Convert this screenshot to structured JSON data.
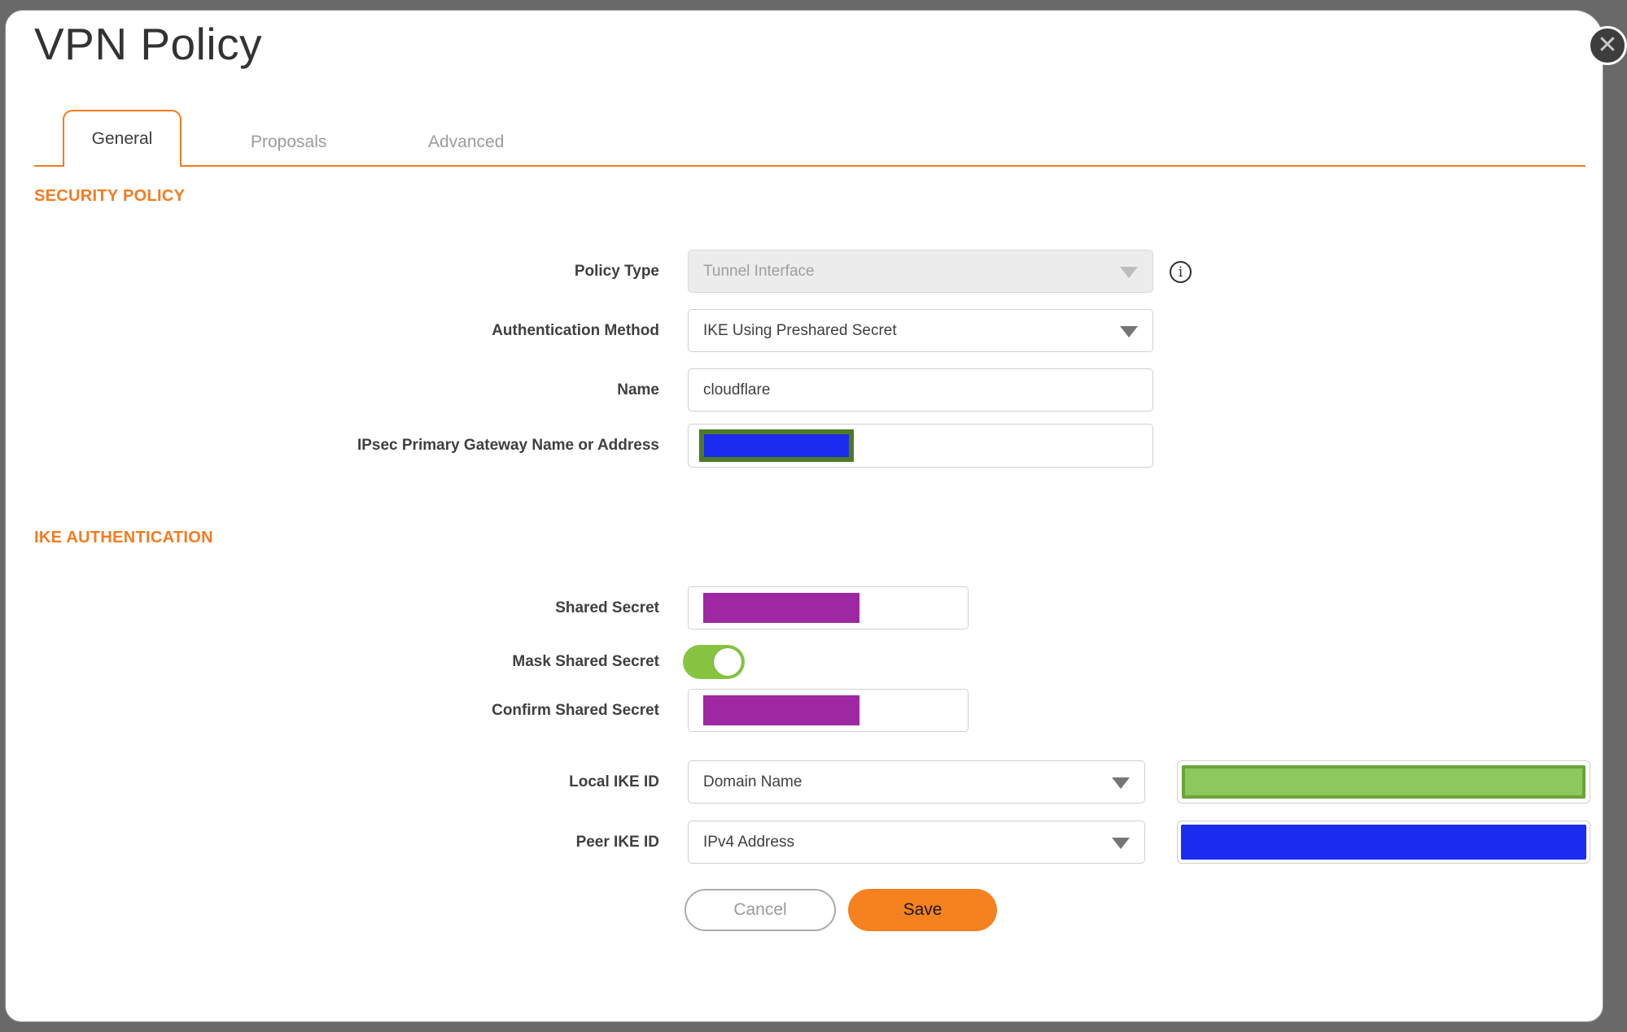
{
  "dialog": {
    "title": "VPN Policy",
    "close_glyph": "✕"
  },
  "tabs": {
    "general": {
      "label": "General",
      "active": true
    },
    "proposals": {
      "label": "Proposals",
      "active": false
    },
    "advanced": {
      "label": "Advanced",
      "active": false
    }
  },
  "sections": {
    "security_policy": {
      "heading": "SECURITY POLICY"
    },
    "ike_authentication": {
      "heading": "IKE AUTHENTICATION"
    }
  },
  "fields": {
    "policy_type": {
      "label": "Policy Type",
      "value": "Tunnel Interface",
      "disabled": true
    },
    "authentication_method": {
      "label": "Authentication Method",
      "value": "IKE Using Preshared Secret"
    },
    "name": {
      "label": "Name",
      "value": "cloudflare"
    },
    "ipsec_primary_gateway": {
      "label": "IPsec Primary Gateway Name or Address",
      "value_redacted": true
    },
    "shared_secret": {
      "label": "Shared Secret",
      "value_redacted": true
    },
    "mask_shared_secret": {
      "label": "Mask Shared Secret",
      "state": "on"
    },
    "confirm_shared_secret": {
      "label": "Confirm Shared Secret",
      "value_redacted": true
    },
    "local_ike_id": {
      "label": "Local IKE ID",
      "value": "Domain Name",
      "id_value_redacted": true
    },
    "peer_ike_id": {
      "label": "Peer IKE ID",
      "value": "IPv4 Address",
      "id_value_redacted": true
    }
  },
  "icons": {
    "info_glyph": "i"
  },
  "buttons": {
    "cancel": "Cancel",
    "save": "Save"
  },
  "colors": {
    "accent_orange": "#f47b20",
    "save_orange": "#f6821f",
    "redaction_blue": "#1b2cf0",
    "redaction_purple": "#9e28a2",
    "redaction_green_fill": "#8cc85c",
    "redaction_green_border": "#6ba33b",
    "redaction_olive_border": "#4e7a23",
    "toggle_green": "#87c540",
    "backdrop_gray": "#696969"
  }
}
